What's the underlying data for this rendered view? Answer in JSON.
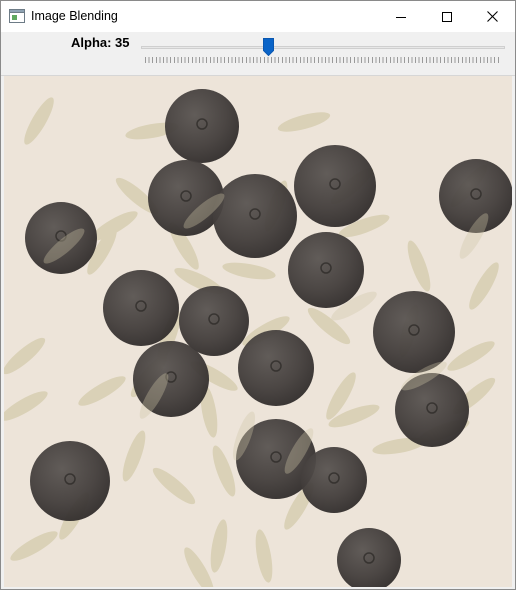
{
  "window": {
    "title": "Image Blending"
  },
  "icons": {
    "app": "app-window-icon",
    "minimize": "minimize-icon",
    "maximize": "maximize-icon",
    "close": "close-icon"
  },
  "trackbar": {
    "label": "Alpha: 35",
    "value": 35,
    "min": 0,
    "max": 100
  },
  "colors": {
    "thumb": "#0a64c8",
    "background": "#ede4d9",
    "blueberry": "#3f3a38",
    "rice": "#d4ccb0"
  },
  "image": {
    "content": "blended-photo-blueberries-rice"
  }
}
